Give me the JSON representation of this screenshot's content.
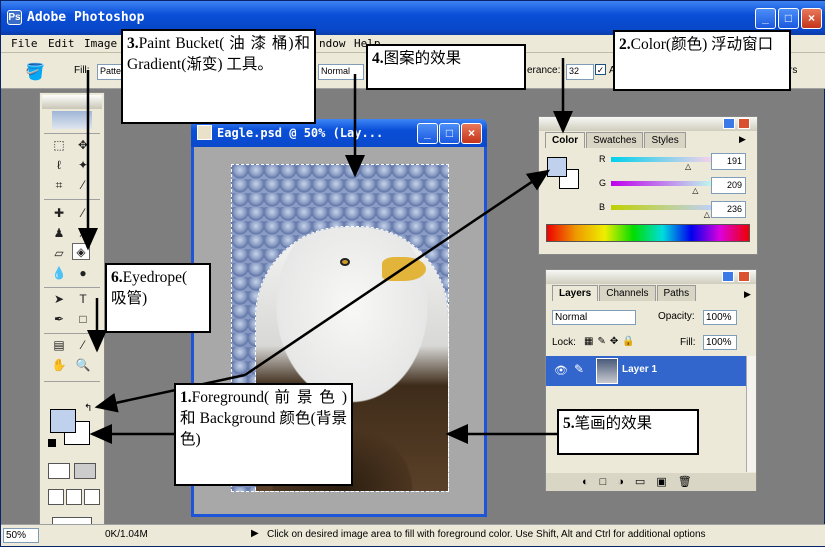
{
  "app": {
    "title": "Adobe Photoshop",
    "logo": "Ps",
    "window_buttons": {
      "minimize": "_",
      "maximize": "□",
      "close": "×"
    }
  },
  "menu": [
    "File",
    "Edit",
    "Image",
    "ndow",
    "Help"
  ],
  "options_bar": {
    "fill_label": "Fill:",
    "fill_value": "Patte",
    "mode_value": "Normal",
    "tolerance_label": "erance:",
    "tolerance_value": "32",
    "antialias_label": "A",
    "trailing_label": "rs"
  },
  "document": {
    "title": "Eagle.psd @ 50% (Lay...",
    "size_info": "0K/1.04M"
  },
  "color_palette": {
    "tabs": [
      "Color",
      "Swatches",
      "Styles"
    ],
    "channels": [
      {
        "label": "R",
        "value": "191",
        "gradient": [
          "#00d1ec",
          "#ffd1ec"
        ],
        "position": 0.75
      },
      {
        "label": "G",
        "value": "209",
        "gradient": [
          "#bf00ec",
          "#bfffec"
        ],
        "position": 0.82
      },
      {
        "label": "B",
        "value": "236",
        "gradient": [
          "#bfd100",
          "#bfd1ff"
        ],
        "position": 0.93
      }
    ],
    "foreground_color": "#bfd1ec",
    "background_color": "#ffffff"
  },
  "layers_palette": {
    "tabs": [
      "Layers",
      "Channels",
      "Paths"
    ],
    "blend_mode": "Normal",
    "opacity_label": "Opacity:",
    "opacity_value": "100%",
    "lock_label": "Lock:",
    "fill_label": "Fill:",
    "fill_value": "100%",
    "layer_name": "Layer 1"
  },
  "status_bar": {
    "zoom": "50%",
    "message": "Click on desired image area to fill with foreground color.  Use Shift, Alt and Ctrl for additional options"
  },
  "callouts": {
    "c1_num": "1.",
    "c1_text": "Foreground( 前 景 色 ) 和 Background 颜色(背景色)",
    "c2_num": "2.",
    "c2_text": "Color(颜色) 浮动窗口",
    "c3_num": "3.",
    "c3_text": "Paint Bucket( 油 漆 桶)和 Gradient(渐变) 工具。",
    "c4_num": "4.",
    "c4_text": "图案的效果",
    "c5_num": "5.",
    "c5_text": "笔画的效果",
    "c6_num": "6.",
    "c6_text": "Eyedrope( 吸管)"
  },
  "colors": {
    "xp_blue": "#0a4fd8",
    "selected_layer": "#3266cc",
    "panel_bg": "#ece9d8",
    "workspace": "#7e7e7e"
  }
}
